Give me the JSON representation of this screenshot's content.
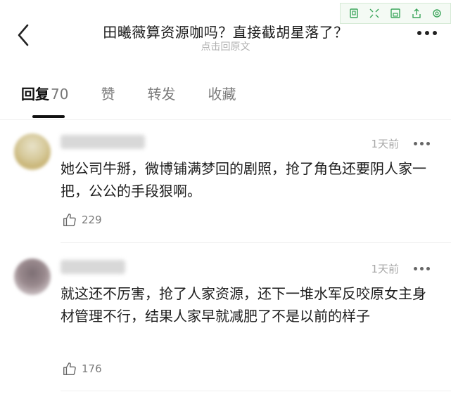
{
  "header": {
    "title": "田曦薇算资源咖吗？直接截胡星落了？",
    "subtitle": "点击回原文"
  },
  "tabs": [
    {
      "label": "回复",
      "count": "70"
    },
    {
      "label": "赞"
    },
    {
      "label": "转发"
    },
    {
      "label": "收藏"
    }
  ],
  "comments": [
    {
      "time": "1天前",
      "text": "她公司牛掰，微博铺满梦回的剧照，抢了角色还要阴人家一把，公公的手段狠啊。",
      "likes": "229"
    },
    {
      "time": "1天前",
      "text": "就这还不厉害，抢了人家资源，还下一堆水军反咬原女主身材管理不行，结果人家早就减肥了不是以前的样子",
      "likes": "176"
    }
  ],
  "colors": {
    "tab_active": "#111111",
    "tab_inactive": "#7a7a7a",
    "muted": "#a8a8a8"
  }
}
